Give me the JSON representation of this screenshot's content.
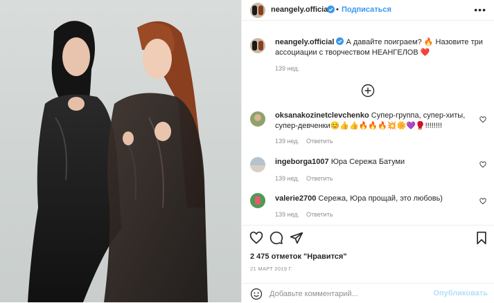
{
  "header": {
    "username": "neangely.official",
    "separator": "•",
    "follow_label": "Подписаться",
    "more_label": "•••"
  },
  "caption": {
    "username": "neangely.official",
    "text": "А давайте поиграем? 🔥 Назовите три ассоциации с творчеством НЕАНГЕЛОВ ❤️",
    "time": "139 нед."
  },
  "comments": [
    {
      "username": "oksanakozinetclevchenko",
      "text": "Супер-группа, супер-хиты, супер-девченки😊👍👍🔥🔥🔥💥🌼💜🥊!!!!!!!!",
      "time": "139 нед.",
      "reply_label": "Ответить"
    },
    {
      "username": "ingeborga1007",
      "text": "Юра Сережа Батуми",
      "time": "139 нед.",
      "reply_label": "Ответить"
    },
    {
      "username": "valerie2700",
      "text": "Сережа, Юра прощай, это любовь)",
      "time": "139 нед.",
      "reply_label": "Ответить"
    }
  ],
  "actions": {
    "likes_text": "2 475 отметок \"Нравится\"",
    "date": "21 МАРТ 2019 Г."
  },
  "add_comment": {
    "placeholder": "Добавьте комментарий...",
    "publish_label": "Опубликовать"
  },
  "colors": {
    "link": "#3897f0",
    "verified": "#3897f0",
    "muted": "#8e8e8e",
    "publish_disabled": "#b2dffc"
  },
  "icons": {
    "verified": "verified-badge-icon",
    "more": "more-options-icon",
    "load_more": "plus-circle-icon",
    "comment_like": "heart-outline-icon",
    "like": "heart-outline-icon",
    "comment": "comment-bubble-icon",
    "share": "paper-plane-icon",
    "save": "bookmark-icon",
    "emoji": "smiley-icon"
  }
}
